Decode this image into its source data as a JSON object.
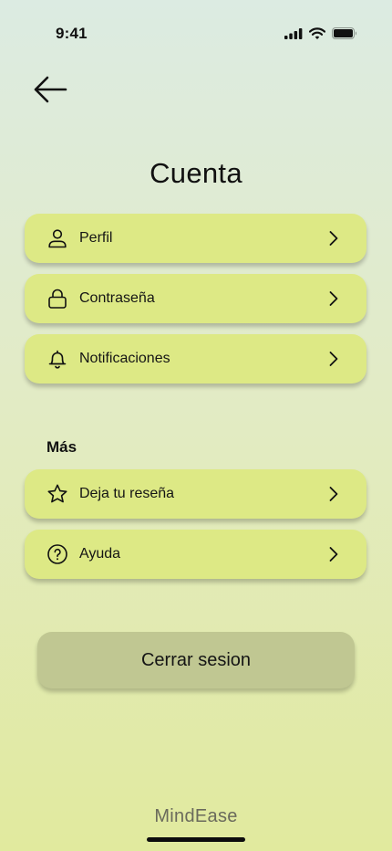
{
  "status_bar": {
    "time": "9:41"
  },
  "header": {
    "title": "Cuenta"
  },
  "account_items": [
    {
      "label": "Perfil",
      "icon": "user-icon"
    },
    {
      "label": "Contraseña",
      "icon": "lock-icon"
    },
    {
      "label": "Notificaciones",
      "icon": "bell-icon"
    }
  ],
  "more_section": {
    "title": "Más",
    "items": [
      {
        "label": "Deja tu reseña",
        "icon": "star-icon"
      },
      {
        "label": "Ayuda",
        "icon": "help-circle-icon"
      }
    ]
  },
  "logout": {
    "label": "Cerrar sesion"
  },
  "footer": {
    "brand": "MindEase"
  },
  "colors": {
    "item_background": "#dde985",
    "logout_background": "#c0c792",
    "brand_text": "#6a6a5c"
  }
}
